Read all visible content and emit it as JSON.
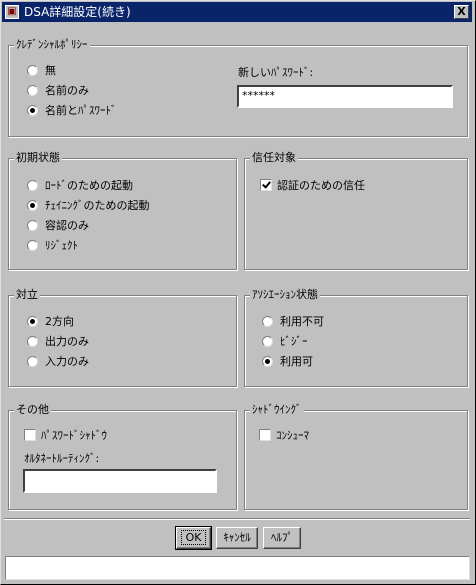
{
  "window": {
    "title": "DSA詳細設定(続き)",
    "close_label": "X"
  },
  "credential_policy": {
    "label": "ｸﾚﾃﾞﾝｼｬﾙﾎﾟﾘｼｰ",
    "options": [
      {
        "label": "無",
        "selected": false
      },
      {
        "label": "名前のみ",
        "selected": false
      },
      {
        "label": "名前とﾊﾟｽﾜｰﾄﾞ",
        "selected": true
      }
    ],
    "new_password_label": "新しいﾊﾟｽﾜｰﾄﾞ:",
    "new_password_value": "******"
  },
  "initial_state": {
    "label": "初期状態",
    "options": [
      {
        "label": "ﾛｰﾄﾞのための起動",
        "selected": false
      },
      {
        "label": "ﾁｪｲﾆﾝｸﾞのための起動",
        "selected": true
      },
      {
        "label": "容認のみ",
        "selected": false
      },
      {
        "label": "ﾘｼﾞｪｸﾄ",
        "selected": false
      }
    ]
  },
  "trust_target": {
    "label": "信任対象",
    "checkbox": {
      "label": "認証のための信任",
      "checked": true
    }
  },
  "direction": {
    "label": "対立",
    "options": [
      {
        "label": "2方向",
        "selected": true
      },
      {
        "label": "出力のみ",
        "selected": false
      },
      {
        "label": "入力のみ",
        "selected": false
      }
    ]
  },
  "association_state": {
    "label": "ｱｿｼｴｰｼｮﾝ状態",
    "options": [
      {
        "label": "利用不可",
        "selected": false
      },
      {
        "label": "ﾋﾞｼﾞｰ",
        "selected": false
      },
      {
        "label": "利用可",
        "selected": true
      }
    ]
  },
  "other": {
    "label": "その他",
    "password_shadow": {
      "label": "ﾊﾟｽﾜｰﾄﾞｼｬﾄﾞｳ",
      "checked": false
    },
    "alt_routing_label": "ｵﾙﾀﾈｰﾄﾙｰﾃｨﾝｸﾞ:",
    "alt_routing_value": ""
  },
  "shadowing": {
    "label": "ｼｬﾄﾞｳｲﾝｸﾞ",
    "consumer": {
      "label": "ｺﾝｼｭｰﾏ",
      "checked": false
    }
  },
  "buttons": {
    "ok": "OK",
    "cancel": "ｷｬﾝｾﾙ",
    "help": "ﾍﾙﾌﾟ"
  },
  "status": ""
}
